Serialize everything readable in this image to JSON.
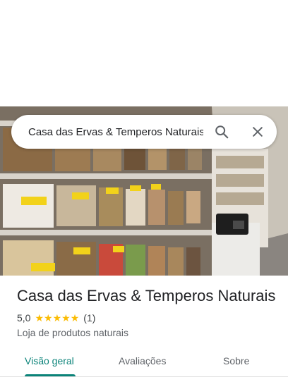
{
  "search": {
    "query": "Casa das Ervas & Temperos Naturais"
  },
  "icons": {
    "search": "search-icon",
    "close": "close-icon",
    "star": "star-icon"
  },
  "place": {
    "name": "Casa das Ervas & Temperos Naturais",
    "rating": "5,0",
    "stars": 5,
    "review_count": "(1)",
    "category": "Loja de produtos naturais"
  },
  "tabs": [
    {
      "label": "Visão geral",
      "active": true
    },
    {
      "label": "Avaliações",
      "active": false
    },
    {
      "label": "Sobre",
      "active": false
    }
  ],
  "colors": {
    "accent": "#0b8379",
    "star": "#fbbc04"
  }
}
